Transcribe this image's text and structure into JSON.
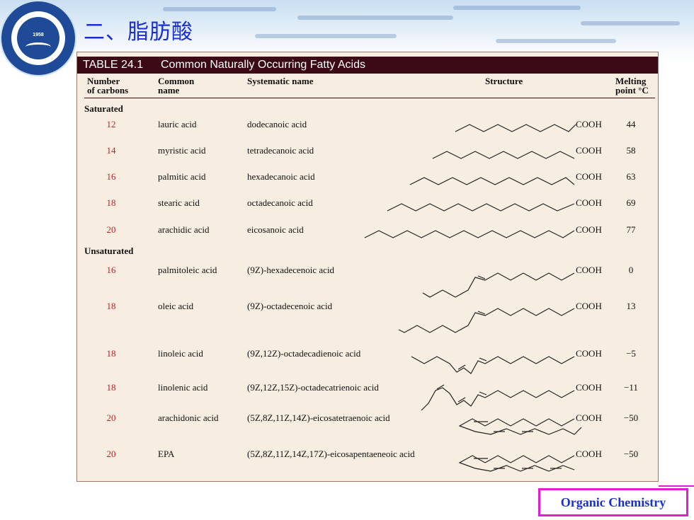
{
  "slide": {
    "title": "二、脂肪酸"
  },
  "logo": {
    "year": "1958"
  },
  "table": {
    "number": "TABLE 24.1",
    "title": "Common Naturally Occurring Fatty Acids",
    "headers": {
      "carbons_1": "Number",
      "carbons_2": "of carbons",
      "common_1": "Common",
      "common_2": "name",
      "systematic": "Systematic name",
      "structure": "Structure",
      "mp_1": "Melting",
      "mp_2": "point °C"
    },
    "groups": {
      "saturated": "Saturated",
      "unsaturated": "Unsaturated"
    },
    "rows": [
      {
        "carbons": "12",
        "common": "lauric acid",
        "systematic": "dodecanoic acid",
        "cooh": "COOH",
        "mp": "44"
      },
      {
        "carbons": "14",
        "common": "myristic acid",
        "systematic": "tetradecanoic acid",
        "cooh": "COOH",
        "mp": "58"
      },
      {
        "carbons": "16",
        "common": "palmitic acid",
        "systematic": "hexadecanoic acid",
        "cooh": "COOH",
        "mp": "63"
      },
      {
        "carbons": "18",
        "common": "stearic acid",
        "systematic": "octadecanoic acid",
        "cooh": "COOH",
        "mp": "69"
      },
      {
        "carbons": "20",
        "common": "arachidic acid",
        "systematic": "eicosanoic acid",
        "cooh": "COOH",
        "mp": "77"
      },
      {
        "carbons": "16",
        "common": "palmitoleic acid",
        "systematic": "(9Z)-hexadecenoic acid",
        "cooh": "COOH",
        "mp": "0"
      },
      {
        "carbons": "18",
        "common": "oleic acid",
        "systematic": "(9Z)-octadecenoic acid",
        "cooh": "COOH",
        "mp": "13"
      },
      {
        "carbons": "18",
        "common": "linoleic acid",
        "systematic": "(9Z,12Z)-octadecadienoic acid",
        "cooh": "COOH",
        "mp": "−5"
      },
      {
        "carbons": "18",
        "common": "linolenic acid",
        "systematic": "(9Z,12Z,15Z)-octadecatrienoic acid",
        "cooh": "COOH",
        "mp": "−11"
      },
      {
        "carbons": "20",
        "common": "arachidonic acid",
        "systematic": "(5Z,8Z,11Z,14Z)-eicosatetraenoic acid",
        "cooh": "COOH",
        "mp": "−50"
      },
      {
        "carbons": "20",
        "common": "EPA",
        "systematic": "(5Z,8Z,11Z,14Z,17Z)-eicosapentaeneoic acid",
        "cooh": "COOH",
        "mp": "−50"
      }
    ]
  },
  "footer": {
    "label": "Organic Chemistry"
  },
  "colors": {
    "title": "#1a2fd6",
    "carbon_number": "#b3262a",
    "table_bar": "#3b0a14",
    "panel": "#f8ede1",
    "footer_border": "#e020d0"
  }
}
